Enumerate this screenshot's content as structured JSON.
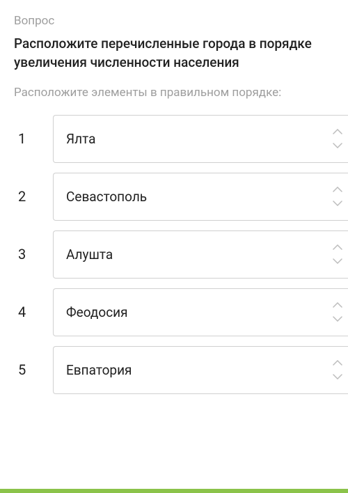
{
  "question_label": "Вопрос",
  "question_text": "Расположите перечисленные города в порядке увеличения численности населения",
  "instruction": "Расположите элементы в правильном порядке:",
  "items": [
    {
      "number": "1",
      "label": "Ялта"
    },
    {
      "number": "2",
      "label": "Севастополь"
    },
    {
      "number": "3",
      "label": "Алушта"
    },
    {
      "number": "4",
      "label": "Феодосия"
    },
    {
      "number": "5",
      "label": "Евпатория"
    }
  ]
}
